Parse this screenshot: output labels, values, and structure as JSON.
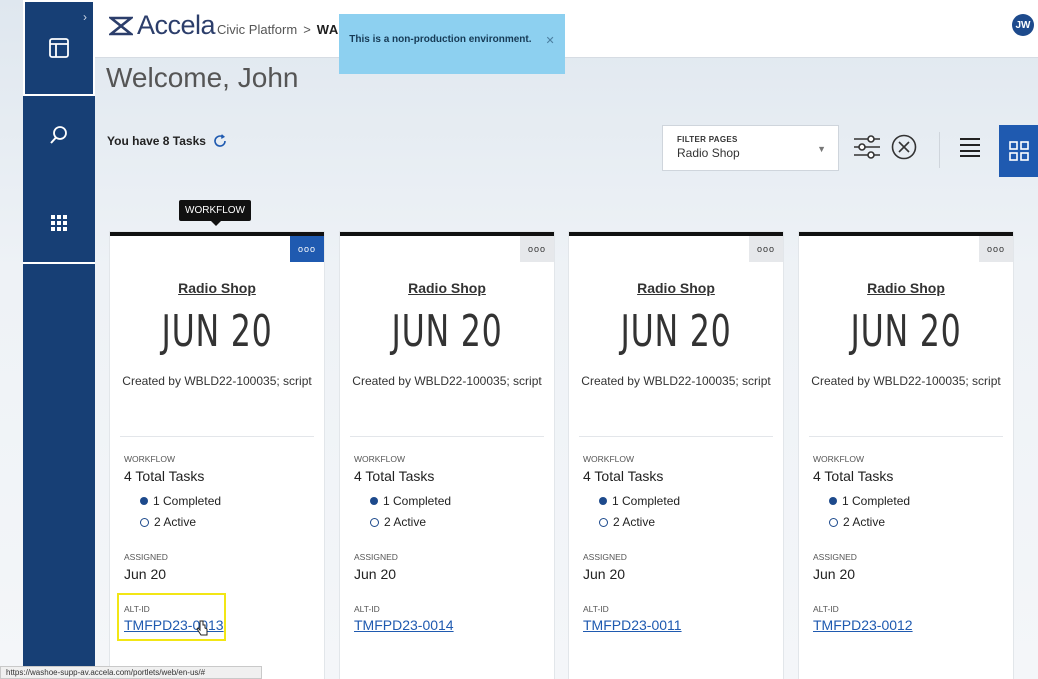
{
  "header": {
    "brand": "Accela",
    "platform": "Civic Platform",
    "separator": ">",
    "agency": "WASHOE",
    "agency_caret": "▾",
    "avatar_initials": "JW"
  },
  "env_banner": {
    "text": "This is a non-production environment.",
    "close": "✕"
  },
  "welcome": "Welcome, John",
  "tasks_count": "You have 8 Tasks",
  "filter": {
    "label": "FILTER PAGES",
    "value": "Radio Shop",
    "caret": "▼"
  },
  "tooltip": "WORKFLOW",
  "cards": [
    {
      "title": "Radio Shop",
      "date": "JUN 20",
      "created": "Created by WBLD22-100035; script",
      "workflow_label": "WORKFLOW",
      "total": "4 Total Tasks",
      "completed": "1 Completed",
      "active": "2 Active",
      "assigned_label": "ASSIGNED",
      "assigned": "Jun 20",
      "altid_label": "ALT-ID",
      "altid": "TMFPD23-0013",
      "menu": "ooo"
    },
    {
      "title": "Radio Shop",
      "date": "JUN 20",
      "created": "Created by WBLD22-100035; script",
      "workflow_label": "WORKFLOW",
      "total": "4 Total Tasks",
      "completed": "1 Completed",
      "active": "2 Active",
      "assigned_label": "ASSIGNED",
      "assigned": "Jun 20",
      "altid_label": "ALT-ID",
      "altid": "TMFPD23-0014",
      "menu": "ooo"
    },
    {
      "title": "Radio Shop",
      "date": "JUN 20",
      "created": "Created by WBLD22-100035; script",
      "workflow_label": "WORKFLOW",
      "total": "4 Total Tasks",
      "completed": "1 Completed",
      "active": "2 Active",
      "assigned_label": "ASSIGNED",
      "assigned": "Jun 20",
      "altid_label": "ALT-ID",
      "altid": "TMFPD23-0011",
      "menu": "ooo"
    },
    {
      "title": "Radio Shop",
      "date": "JUN 20",
      "created": "Created by WBLD22-100035; script",
      "workflow_label": "WORKFLOW",
      "total": "4 Total Tasks",
      "completed": "1 Completed",
      "active": "2 Active",
      "assigned_label": "ASSIGNED",
      "assigned": "Jun 20",
      "altid_label": "ALT-ID",
      "altid": "TMFPD23-0012",
      "menu": "ooo"
    }
  ],
  "status_url": "https://washoe-supp-av.accela.com/portlets/web/en-us/#",
  "colors": {
    "nav": "#173f75",
    "accent": "#1f5ab0",
    "banner": "#8dd0f0",
    "highlight": "#f2e615"
  },
  "icons": [
    "dashboard-icon",
    "search-icon",
    "apps-grid-icon",
    "refresh-icon",
    "filter-settings-icon",
    "clear-filter-icon",
    "list-view-icon",
    "grid-view-icon",
    "card-menu-icon",
    "mouse-cursor-icon"
  ]
}
